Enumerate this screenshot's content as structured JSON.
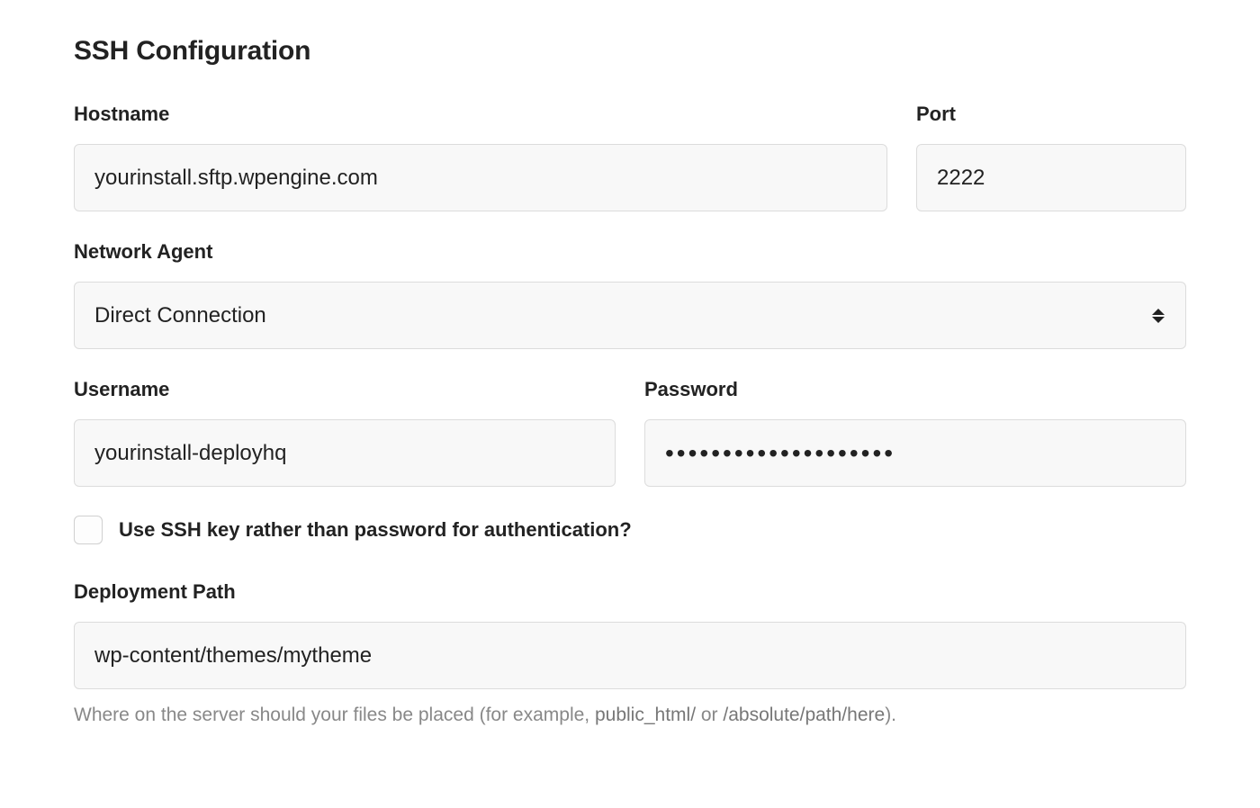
{
  "title": "SSH Configuration",
  "fields": {
    "hostname": {
      "label": "Hostname",
      "value": "yourinstall.sftp.wpengine.com"
    },
    "port": {
      "label": "Port",
      "value": "2222"
    },
    "network_agent": {
      "label": "Network Agent",
      "selected": "Direct Connection"
    },
    "username": {
      "label": "Username",
      "value": "yourinstall-deployhq"
    },
    "password": {
      "label": "Password",
      "masked": "••••••••••••••••••••"
    },
    "ssh_key_checkbox": {
      "label": "Use SSH key rather than password for authentication?",
      "checked": false
    },
    "deployment_path": {
      "label": "Deployment Path",
      "value": "wp-content/themes/mytheme",
      "help_prefix": "Where on the server should your files be placed (for example, ",
      "help_example1": "public_html/",
      "help_mid": " or ",
      "help_example2": "/absolute/path/here",
      "help_suffix": ")."
    }
  }
}
